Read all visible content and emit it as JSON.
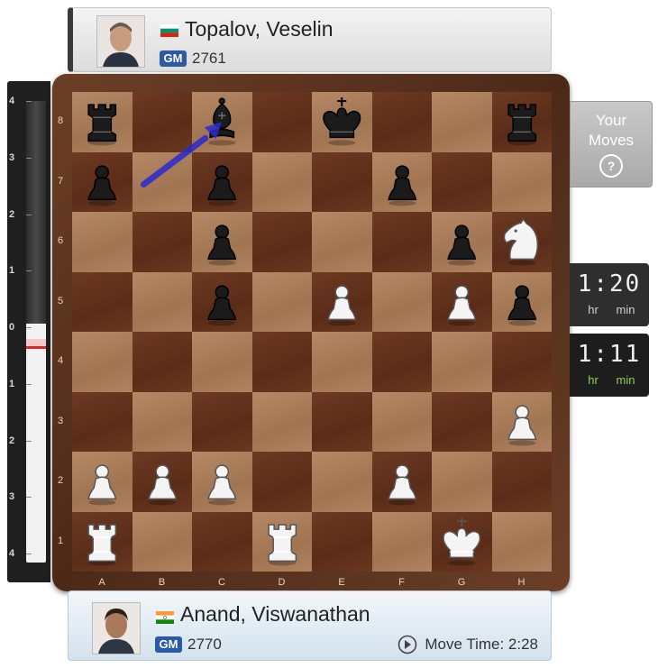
{
  "top_player": {
    "name": "Topalov, Veselin",
    "title": "GM",
    "rating": "2761",
    "flag": "bulgaria-flag"
  },
  "bottom_player": {
    "name": "Anand, Viswanathan",
    "title": "GM",
    "rating": "2770",
    "flag": "india-flag",
    "move_time": "Move Time: 2:28"
  },
  "eval_bar": {
    "ticks_top": [
      "4",
      "3",
      "2",
      "1",
      "0"
    ],
    "ticks_bottom": [
      "1",
      "2",
      "3",
      "4"
    ],
    "level": 0.04
  },
  "board": {
    "files": [
      "A",
      "B",
      "C",
      "D",
      "E",
      "F",
      "G",
      "H"
    ],
    "ranks": [
      "8",
      "7",
      "6",
      "5",
      "4",
      "3",
      "2",
      "1"
    ],
    "position": [
      [
        "bR",
        "",
        "bB",
        "",
        "bK",
        "",
        "",
        "bR"
      ],
      [
        "bP",
        "",
        "bP",
        "",
        "",
        "bP",
        "",
        ""
      ],
      [
        "",
        "",
        "bP",
        "",
        "",
        "",
        "bP",
        "wN"
      ],
      [
        "",
        "",
        "bP",
        "",
        "wP",
        "",
        "wP",
        "bP"
      ],
      [
        "",
        "",
        "",
        "",
        "",
        "",
        "",
        ""
      ],
      [
        "",
        "",
        "",
        "",
        "",
        "",
        "",
        "wP"
      ],
      [
        "wP",
        "wP",
        "wP",
        "",
        "",
        "wP",
        "",
        ""
      ],
      [
        "wR",
        "",
        "",
        "wR",
        "",
        "",
        "wK",
        ""
      ]
    ],
    "arrow": {
      "from": "b7",
      "to": "c8",
      "color": "#2a2ad0"
    }
  },
  "your_moves": {
    "label_line1": "Your",
    "label_line2": "Moves",
    "icon": "help-icon"
  },
  "clock_top": {
    "time": "1:20",
    "unit_hr": "hr",
    "unit_min": "min"
  },
  "clock_bottom": {
    "time": "1:11",
    "unit_hr": "hr",
    "unit_min": "min"
  }
}
